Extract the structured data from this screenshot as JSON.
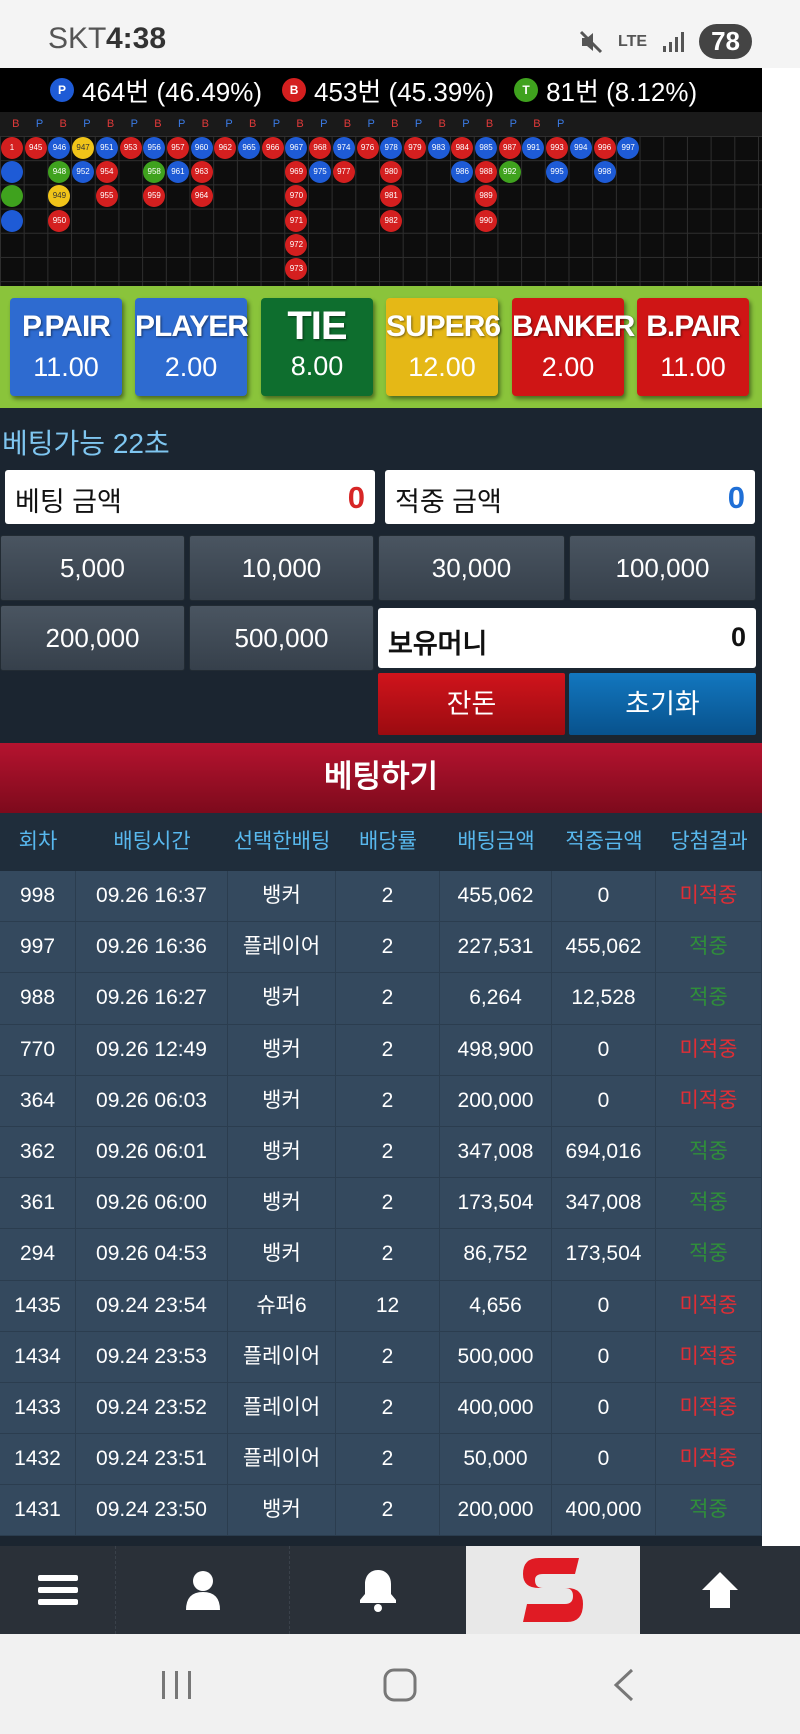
{
  "status_bar": {
    "carrier": "SKT",
    "time": "4:38",
    "battery": "78",
    "network": "LTE"
  },
  "stats": [
    {
      "badge": "P",
      "text": "464번 (46.49%)"
    },
    {
      "badge": "B",
      "text": "453번 (45.39%)"
    },
    {
      "badge": "T",
      "text": "81번 (8.12%)"
    }
  ],
  "road": {
    "header": [
      "B",
      "P",
      "B",
      "P",
      "B",
      "P",
      "B",
      "P",
      "B",
      "P",
      "B",
      "P",
      "B",
      "P",
      "B",
      "P",
      "B",
      "P",
      "B",
      "P",
      "B",
      "P",
      "B",
      "P"
    ],
    "beads": [
      {
        "n": "1",
        "c": "b"
      },
      {
        "n": "945",
        "c": "b"
      },
      {
        "n": "946",
        "c": "p"
      },
      {
        "n": "947",
        "c": "y"
      },
      {
        "n": "951",
        "c": "p"
      },
      {
        "n": "953",
        "c": "b"
      },
      {
        "n": "956",
        "c": "p"
      },
      {
        "n": "957",
        "c": "b"
      },
      {
        "n": "960",
        "c": "p"
      },
      {
        "n": "962",
        "c": "b"
      },
      {
        "n": "965",
        "c": "p"
      },
      {
        "n": "966",
        "c": "b"
      },
      {
        "n": "967",
        "c": "p"
      },
      {
        "n": "968",
        "c": "b"
      },
      {
        "n": "974",
        "c": "p"
      },
      {
        "n": "976",
        "c": "b"
      },
      {
        "n": "978",
        "c": "p"
      },
      {
        "n": "979",
        "c": "b"
      },
      {
        "n": "983",
        "c": "p"
      },
      {
        "n": "984",
        "c": "b"
      },
      {
        "n": "985",
        "c": "p"
      },
      {
        "n": "987",
        "c": "b"
      },
      {
        "n": "991",
        "c": "p"
      },
      {
        "n": "993",
        "c": "b"
      },
      {
        "n": "994",
        "c": "p"
      },
      {
        "n": "996",
        "c": "b"
      },
      {
        "n": "997",
        "c": "p"
      }
    ],
    "beads_row2": [
      {
        "n": "",
        "c": "p",
        "col": 0
      },
      {
        "n": "948",
        "c": "g",
        "col": 2
      },
      {
        "n": "952",
        "c": "p",
        "col": 3
      },
      {
        "n": "954",
        "c": "b",
        "col": 4
      },
      {
        "n": "958",
        "c": "g",
        "col": 6
      },
      {
        "n": "961",
        "c": "p",
        "col": 7
      },
      {
        "n": "963",
        "c": "b",
        "col": 8
      },
      {
        "n": "969",
        "c": "b",
        "col": 12
      },
      {
        "n": "975",
        "c": "p",
        "col": 13
      },
      {
        "n": "977",
        "c": "b",
        "col": 14
      },
      {
        "n": "980",
        "c": "b",
        "col": 16
      },
      {
        "n": "986",
        "c": "p",
        "col": 19
      },
      {
        "n": "988",
        "c": "b",
        "col": 20
      },
      {
        "n": "992",
        "c": "g",
        "col": 21
      },
      {
        "n": "995",
        "c": "p",
        "col": 23
      },
      {
        "n": "998",
        "c": "p",
        "col": 25
      }
    ],
    "beads_row3": [
      {
        "n": "",
        "c": "g",
        "col": 0
      },
      {
        "n": "949",
        "c": "y",
        "col": 2
      },
      {
        "n": "955",
        "c": "b",
        "col": 4
      },
      {
        "n": "959",
        "c": "b",
        "col": 6
      },
      {
        "n": "964",
        "c": "b",
        "col": 8
      },
      {
        "n": "970",
        "c": "b",
        "col": 12
      },
      {
        "n": "981",
        "c": "b",
        "col": 16
      },
      {
        "n": "989",
        "c": "b",
        "col": 20
      }
    ],
    "beads_row4": [
      {
        "n": "",
        "c": "p",
        "col": 0
      },
      {
        "n": "950",
        "c": "b",
        "col": 2
      },
      {
        "n": "971",
        "c": "b",
        "col": 12
      },
      {
        "n": "982",
        "c": "b",
        "col": 16
      },
      {
        "n": "990",
        "c": "b",
        "col": 20
      }
    ],
    "beads_row5": [
      {
        "n": "972",
        "c": "b",
        "col": 12
      }
    ],
    "beads_row6": [
      {
        "n": "973",
        "c": "b",
        "col": 12
      }
    ]
  },
  "bet_options": [
    {
      "label": "P.PAIR",
      "odds": "11.00",
      "color": "#2e6bd0"
    },
    {
      "label": "PLAYER",
      "odds": "2.00",
      "color": "#2e6bd0"
    },
    {
      "label": "TIE",
      "odds": "8.00",
      "color": "#0e6e2e"
    },
    {
      "label": "SUPER6",
      "odds": "12.00",
      "color": "#e5b816"
    },
    {
      "label": "BANKER",
      "odds": "2.00",
      "color": "#cf1515"
    },
    {
      "label": "B.PAIR",
      "odds": "11.00",
      "color": "#cf1515"
    }
  ],
  "countdown": "베팅가능 22초",
  "bet_amount": {
    "label": "베팅 금액",
    "value": "0"
  },
  "win_amount": {
    "label": "적중 금액",
    "value": "0"
  },
  "chips": [
    "5,000",
    "10,000",
    "30,000",
    "100,000",
    "200,000",
    "500,000"
  ],
  "holding": {
    "label": "보유머니",
    "value": "0"
  },
  "buttons": {
    "change": "잔돈",
    "reset": "초기화",
    "place": "베팅하기"
  },
  "table": {
    "headers": [
      "회차",
      "배팅시간",
      "선택한배팅",
      "배당률",
      "배팅금액",
      "적중금액",
      "당첨결과"
    ],
    "rows": [
      [
        "998",
        "09.26 16:37",
        "뱅커",
        "2",
        "455,062",
        "0",
        "미적중"
      ],
      [
        "997",
        "09.26 16:36",
        "플레이어",
        "2",
        "227,531",
        "455,062",
        "적중"
      ],
      [
        "988",
        "09.26 16:27",
        "뱅커",
        "2",
        "6,264",
        "12,528",
        "적중"
      ],
      [
        "770",
        "09.26 12:49",
        "뱅커",
        "2",
        "498,900",
        "0",
        "미적중"
      ],
      [
        "364",
        "09.26 06:03",
        "뱅커",
        "2",
        "200,000",
        "0",
        "미적중"
      ],
      [
        "362",
        "09.26 06:01",
        "뱅커",
        "2",
        "347,008",
        "694,016",
        "적중"
      ],
      [
        "361",
        "09.26 06:00",
        "뱅커",
        "2",
        "173,504",
        "347,008",
        "적중"
      ],
      [
        "294",
        "09.26 04:53",
        "뱅커",
        "2",
        "86,752",
        "173,504",
        "적중"
      ],
      [
        "1435",
        "09.24 23:54",
        "슈퍼6",
        "12",
        "4,656",
        "0",
        "미적중"
      ],
      [
        "1434",
        "09.24 23:53",
        "플레이어",
        "2",
        "500,000",
        "0",
        "미적중"
      ],
      [
        "1433",
        "09.24 23:52",
        "플레이어",
        "2",
        "400,000",
        "0",
        "미적중"
      ],
      [
        "1432",
        "09.24 23:51",
        "플레이어",
        "2",
        "50,000",
        "0",
        "미적중"
      ],
      [
        "1431",
        "09.24 23:50",
        "뱅커",
        "2",
        "200,000",
        "400,000",
        "적중"
      ]
    ]
  },
  "nav": {
    "items": [
      "menu-icon",
      "user-icon",
      "bell-icon",
      "s-logo",
      "arrow-up-icon"
    ]
  },
  "colors": {
    "miss": "#e02e35",
    "hit": "#2f8f3a",
    "header_text": "#58b8ee",
    "countdown": "#7fc6f0"
  }
}
